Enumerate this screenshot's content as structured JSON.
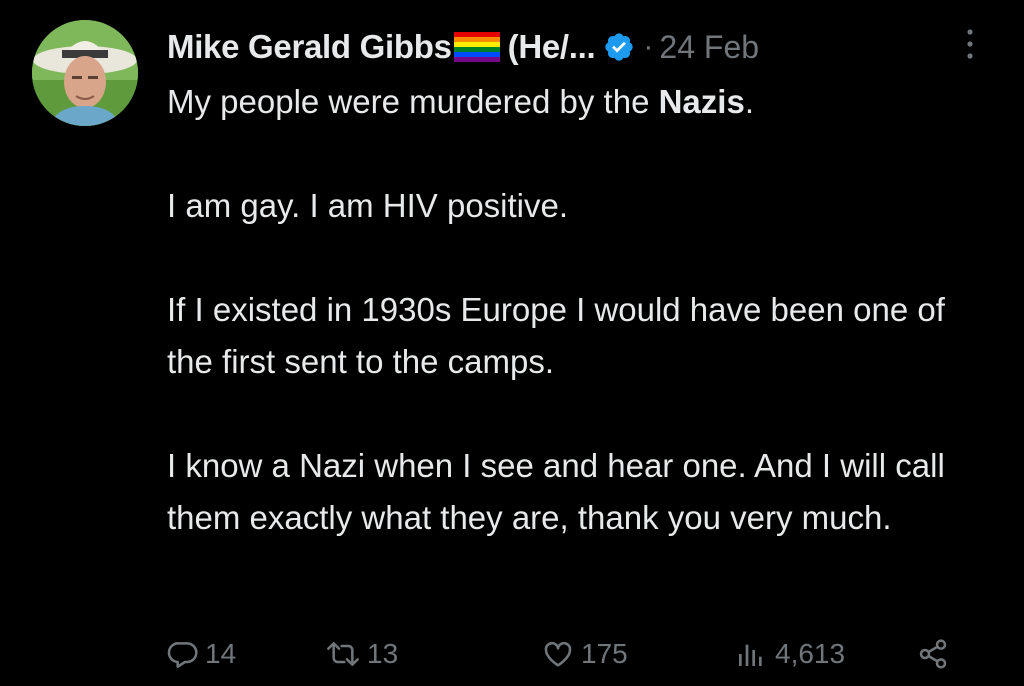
{
  "author": {
    "display_name": "Mike Gerald Gibbs",
    "pronouns": "(He/...",
    "flag_icon": "rainbow-flag-icon",
    "verified_icon": "verified-badge-icon",
    "verified_color": "#1d9bf0"
  },
  "timestamp": {
    "separator": "·",
    "date": "24 Feb"
  },
  "tweet": {
    "p1_before": "My people were murdered by the ",
    "p1_bold": "Nazis",
    "p1_after": ".",
    "p2": "I am gay. I am HIV positive.",
    "p3": "If I existed in 1930s Europe I would have been one of the first sent to the camps.",
    "p4": "I know a Nazi when I see and hear one. And I will call them exactly what they are, thank you very much."
  },
  "actions": {
    "replies": "14",
    "reposts": "13",
    "likes": "175",
    "views": "4,613",
    "icons": [
      "reply-icon",
      "repost-icon",
      "like-icon",
      "views-icon",
      "share-icon"
    ]
  },
  "colors": {
    "background": "#000000",
    "text_primary": "#e7e9ea",
    "text_secondary": "#71767b",
    "accent": "#1d9bf0"
  }
}
